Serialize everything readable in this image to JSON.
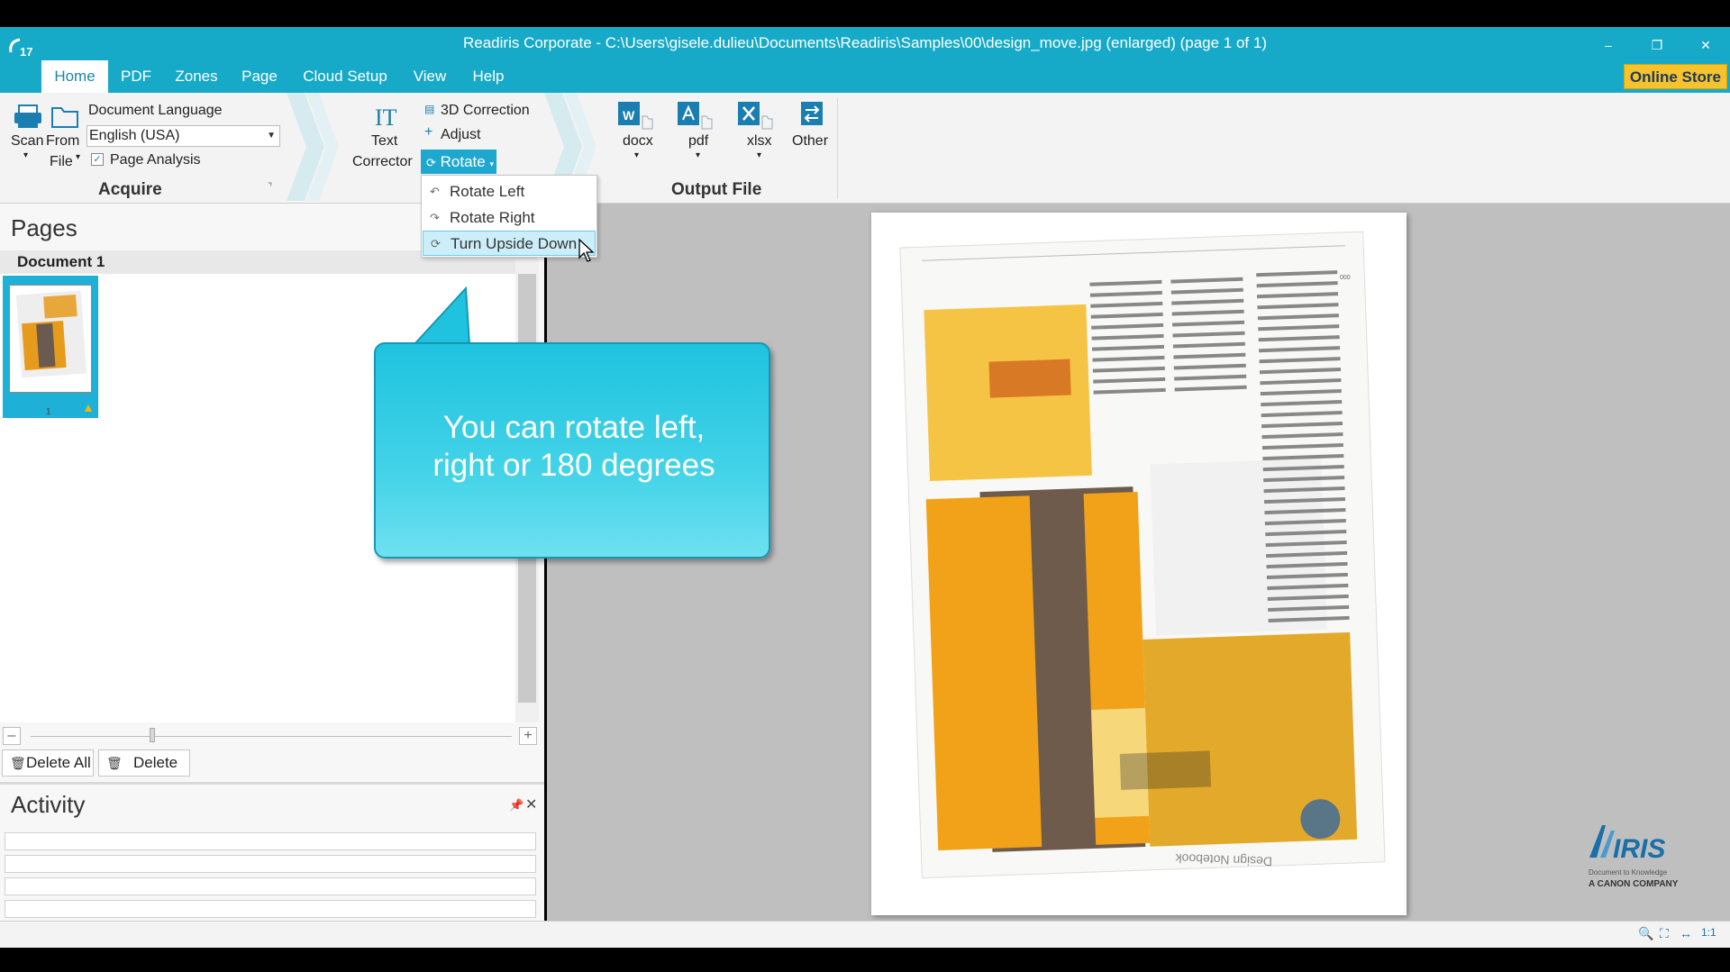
{
  "window": {
    "title": "Readiris Corporate - C:\\Users\\gisele.dulieu\\Documents\\Readiris\\Samples\\00\\design_move.jpg (enlarged) (page 1 of 1)",
    "app_badge": "17",
    "minimize": "–",
    "restore": "❐",
    "close": "✕"
  },
  "tabs": [
    {
      "label": "Home"
    },
    {
      "label": "PDF"
    },
    {
      "label": "Zones"
    },
    {
      "label": "Page"
    },
    {
      "label": "Cloud Setup"
    },
    {
      "label": "View"
    },
    {
      "label": "Help"
    }
  ],
  "online_store": "Online Store",
  "ribbon": {
    "acquire": {
      "scan_label": "Scan",
      "from_file_label_1": "From",
      "from_file_label_2": "File",
      "doc_language_label": "Document Language",
      "language_value": "English (USA)",
      "page_analysis_label": "Page Analysis",
      "page_analysis_checked": "✓",
      "group_title": "Acquire"
    },
    "text_corrector_1": "Text",
    "text_corrector_2": "Corrector",
    "correction_3d": "3D Correction",
    "adjust": "Adjust",
    "rotate": "Rotate",
    "output": {
      "docx": "docx",
      "pdf": "pdf",
      "xlsx": "xlsx",
      "other": "Other",
      "group_title": "Output File"
    }
  },
  "rotate_menu": {
    "items": [
      {
        "label": "Rotate Left"
      },
      {
        "label": "Rotate Right"
      },
      {
        "label": "Turn Upside Down"
      }
    ]
  },
  "pages_panel": {
    "title": "Pages",
    "document_label": "Document 1",
    "thumb_number": "1",
    "delete_all": "Delete All",
    "delete": "Delete",
    "zoom_minus": "–",
    "zoom_plus": "+"
  },
  "activity": {
    "title": "Activity"
  },
  "callout": {
    "line1": "You can rotate left,",
    "line2": "right or 180 degrees"
  },
  "page_document": {
    "footer_text": "Design Notebook",
    "page_num": "000"
  },
  "iris_logo": {
    "word": "IRIS",
    "tagline": "Document to Knowledge",
    "company": "A CANON COMPANY"
  },
  "status": {
    "zoom": "1:1"
  },
  "colors": {
    "accent": "#17a9c8",
    "online_store": "#f6c22d",
    "callout": "#2ccbe3"
  }
}
